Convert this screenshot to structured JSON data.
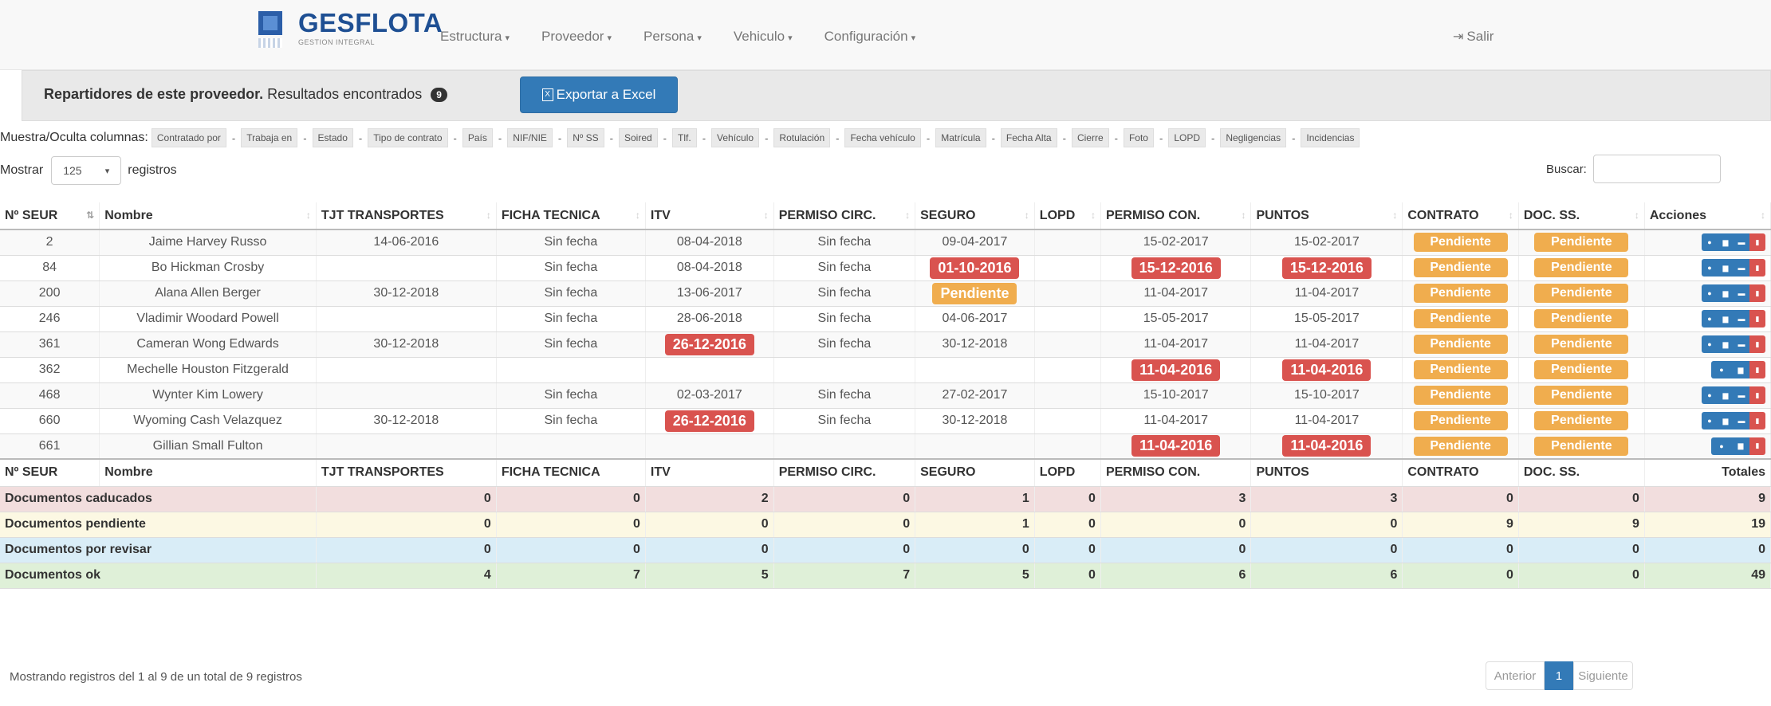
{
  "brand": {
    "title": "GESFLOTA",
    "subtitle": "GESTION INTEGRAL"
  },
  "nav": [
    {
      "label": "Estructura"
    },
    {
      "label": "Proveedor"
    },
    {
      "label": "Persona"
    },
    {
      "label": "Vehiculo"
    },
    {
      "label": "Configuración"
    }
  ],
  "logout": {
    "label": "Salir"
  },
  "panel": {
    "title_bold": "Repartidores de este proveedor.",
    "title_rest": " Resultados encontrados",
    "count": "9",
    "export_label": "Exportar a Excel"
  },
  "toggles": {
    "label": "Muestra/Oculta columnas:",
    "items": [
      "Contratado por",
      "Trabaja en",
      "Estado",
      "Tipo de contrato",
      "País",
      "NIF/NIE",
      "Nº SS",
      "Soired",
      "Tlf.",
      "Vehículo",
      "Rotulación",
      "Fecha vehículo",
      "Matrícula",
      "Fecha Alta",
      "Cierre",
      "Foto",
      "LOPD",
      "Negligencias",
      "Incidencias"
    ]
  },
  "length": {
    "label_before": "Mostrar",
    "value": "125",
    "label_after": "registros"
  },
  "search": {
    "label": "Buscar:",
    "value": ""
  },
  "columns": [
    "Nº SEUR",
    "Nombre",
    "TJT TRANSPORTES",
    "FICHA TECNICA",
    "ITV",
    "PERMISO CIRC.",
    "SEGURO",
    "LOPD",
    "PERMISO CON.",
    "PUNTOS",
    "CONTRATO",
    "DOC. SS.",
    "Acciones"
  ],
  "rows": [
    {
      "seur": "2",
      "nombre": "Jaime Harvey Russo",
      "tjt": "14-06-2016",
      "ficha": "Sin fecha",
      "itv": "08-04-2018",
      "itv_style": "link",
      "permiso_circ": "Sin fecha",
      "seguro": "09-04-2017",
      "seguro_style": "link",
      "lopd": "",
      "permiso_con": "15-02-2017",
      "permiso_con_style": "link",
      "puntos": "15-02-2017",
      "puntos_style": "link",
      "contrato": "Pendiente",
      "doc_ss": "Pendiente",
      "actions": 4
    },
    {
      "seur": "84",
      "nombre": "Bo Hickman Crosby",
      "tjt": "",
      "ficha": "Sin fecha",
      "itv": "08-04-2018",
      "itv_style": "link",
      "permiso_circ": "Sin fecha",
      "seguro": "01-10-2016",
      "seguro_style": "red",
      "lopd": "",
      "permiso_con": "15-12-2016",
      "permiso_con_style": "red",
      "puntos": "15-12-2016",
      "puntos_style": "red",
      "contrato": "Pendiente",
      "doc_ss": "Pendiente",
      "actions": 4
    },
    {
      "seur": "200",
      "nombre": "Alana Allen Berger",
      "tjt": "30-12-2018",
      "ficha": "Sin fecha",
      "itv": "13-06-2017",
      "itv_style": "link",
      "permiso_circ": "Sin fecha",
      "seguro": "Pendiente",
      "seguro_style": "orange",
      "lopd": "",
      "permiso_con": "11-04-2017",
      "permiso_con_style": "link",
      "puntos": "11-04-2017",
      "puntos_style": "link",
      "contrato": "Pendiente",
      "doc_ss": "Pendiente",
      "actions": 4
    },
    {
      "seur": "246",
      "nombre": "Vladimir Woodard Powell",
      "tjt": "",
      "ficha": "Sin fecha",
      "itv": "28-06-2018",
      "itv_style": "link",
      "permiso_circ": "Sin fecha",
      "seguro": "04-06-2017",
      "seguro_style": "link",
      "lopd": "",
      "permiso_con": "15-05-2017",
      "permiso_con_style": "link",
      "puntos": "15-05-2017",
      "puntos_style": "link",
      "contrato": "Pendiente",
      "doc_ss": "Pendiente",
      "actions": 4
    },
    {
      "seur": "361",
      "nombre": "Cameran Wong Edwards",
      "tjt": "30-12-2018",
      "ficha": "Sin fecha",
      "itv": "26-12-2016",
      "itv_style": "red",
      "permiso_circ": "Sin fecha",
      "seguro": "30-12-2018",
      "seguro_style": "link",
      "lopd": "",
      "permiso_con": "11-04-2017",
      "permiso_con_style": "link",
      "puntos": "11-04-2017",
      "puntos_style": "link",
      "contrato": "Pendiente",
      "doc_ss": "Pendiente",
      "actions": 4
    },
    {
      "seur": "362",
      "nombre": "Mechelle Houston Fitzgerald",
      "tjt": "",
      "ficha": "",
      "itv": "",
      "itv_style": "link",
      "permiso_circ": "",
      "seguro": "",
      "seguro_style": "link",
      "lopd": "",
      "permiso_con": "11-04-2016",
      "permiso_con_style": "red",
      "puntos": "11-04-2016",
      "puntos_style": "red",
      "contrato": "Pendiente",
      "doc_ss": "Pendiente",
      "actions": 3
    },
    {
      "seur": "468",
      "nombre": "Wynter Kim Lowery",
      "tjt": "",
      "ficha": "Sin fecha",
      "itv": "02-03-2017",
      "itv_style": "link",
      "permiso_circ": "Sin fecha",
      "seguro": "27-02-2017",
      "seguro_style": "link",
      "lopd": "",
      "permiso_con": "15-10-2017",
      "permiso_con_style": "link",
      "puntos": "15-10-2017",
      "puntos_style": "link",
      "contrato": "Pendiente",
      "doc_ss": "Pendiente",
      "actions": 4
    },
    {
      "seur": "660",
      "nombre": "Wyoming Cash Velazquez",
      "tjt": "30-12-2018",
      "ficha": "Sin fecha",
      "itv": "26-12-2016",
      "itv_style": "red",
      "permiso_circ": "Sin fecha",
      "seguro": "30-12-2018",
      "seguro_style": "link",
      "lopd": "",
      "permiso_con": "11-04-2017",
      "permiso_con_style": "link",
      "puntos": "11-04-2017",
      "puntos_style": "link",
      "contrato": "Pendiente",
      "doc_ss": "Pendiente",
      "actions": 4
    },
    {
      "seur": "661",
      "nombre": "Gillian Small Fulton",
      "tjt": "",
      "ficha": "",
      "itv": "",
      "itv_style": "link",
      "permiso_circ": "",
      "seguro": "",
      "seguro_style": "link",
      "lopd": "",
      "permiso_con": "11-04-2016",
      "permiso_con_style": "red",
      "puntos": "11-04-2016",
      "puntos_style": "red",
      "contrato": "Pendiente",
      "doc_ss": "Pendiente",
      "actions": 3
    }
  ],
  "footer_columns": [
    "Nº SEUR",
    "Nombre",
    "TJT TRANSPORTES",
    "FICHA TECNICA",
    "ITV",
    "PERMISO CIRC.",
    "SEGURO",
    "LOPD",
    "PERMISO CON.",
    "PUNTOS",
    "CONTRATO",
    "DOC. SS.",
    "Totales"
  ],
  "summary": [
    {
      "label": "Documentos caducados",
      "style": "red",
      "values": [
        "0",
        "0",
        "2",
        "0",
        "1",
        "0",
        "3",
        "3",
        "0",
        "0",
        "9"
      ]
    },
    {
      "label": "Documentos pendiente",
      "style": "yellow",
      "values": [
        "0",
        "0",
        "0",
        "0",
        "1",
        "0",
        "0",
        "0",
        "9",
        "9",
        "19"
      ]
    },
    {
      "label": "Documentos por revisar",
      "style": "blue",
      "values": [
        "0",
        "0",
        "0",
        "0",
        "0",
        "0",
        "0",
        "0",
        "0",
        "0",
        "0"
      ]
    },
    {
      "label": "Documentos ok",
      "style": "green",
      "values": [
        "4",
        "7",
        "5",
        "7",
        "5",
        "0",
        "6",
        "6",
        "0",
        "0",
        "49"
      ]
    }
  ],
  "info": "Mostrando registros del 1 al 9 de un total de 9 registros",
  "pager": {
    "prev": "Anterior",
    "current": "1",
    "next": "Siguiente"
  },
  "colors": {
    "primary": "#337ab7",
    "danger": "#d9534f",
    "warning": "#f0ad4e"
  },
  "icons": {
    "logout": "sign-out-icon",
    "export": "file-excel-icon",
    "view": "eye-icon",
    "chart": "bar-chart-icon",
    "card": "id-card-icon",
    "delete": "trash-icon"
  }
}
